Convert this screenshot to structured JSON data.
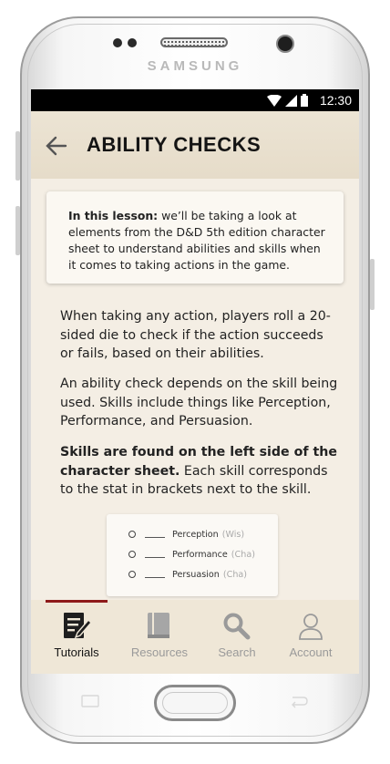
{
  "device": {
    "brand": "SAMSUNG"
  },
  "status_bar": {
    "time": "12:30"
  },
  "header": {
    "title": "ABILITY CHECKS"
  },
  "lesson_card": {
    "lead": "In this lesson:",
    "text": " we’ll be taking a look at elements from the D&D 5th edition character sheet to understand abilities and skills when it comes to taking actions in the game."
  },
  "body": {
    "para1": "When taking any action, players roll a 20-sided die to check if the action succeeds or fails, based on their abilities.",
    "para2": "An ability check depends on the skill being used. Skills include things like Perception, Performance, and Persuasion.",
    "para3_bold": "Skills are found on the left side of the character sheet.",
    "para3_rest": " Each skill corresponds to the stat in brackets next to the skill."
  },
  "skills": [
    {
      "name": "Perception",
      "stat": "(Wis)"
    },
    {
      "name": "Performance",
      "stat": "(Cha)"
    },
    {
      "name": "Persuasion",
      "stat": "(Cha)"
    }
  ],
  "bottom_nav": {
    "items": [
      {
        "label": "Tutorials",
        "icon": "tutorials-icon",
        "active": true
      },
      {
        "label": "Resources",
        "icon": "book-icon",
        "active": false
      },
      {
        "label": "Search",
        "icon": "search-icon",
        "active": false
      },
      {
        "label": "Account",
        "icon": "account-icon",
        "active": false
      }
    ]
  },
  "colors": {
    "background": "#f4eee4",
    "active_indicator": "#8e1a1a",
    "active_text": "#141414",
    "inactive": "#9a9a9a"
  }
}
